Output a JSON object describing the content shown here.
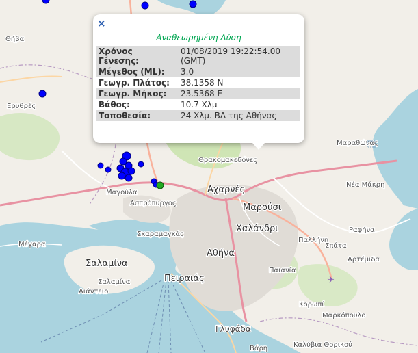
{
  "map": {
    "background_color": "#f2efe9",
    "sea_color": "#aad3df",
    "marker_color_recent": "#0000ff",
    "marker_color_selected": "#22aa22",
    "labels": {
      "thiva": "Θήβα",
      "erythres": "Ερυθρές",
      "magoula": "Μαγούλα",
      "aspropyrgos": "Ασπρόπυργος",
      "acharnes": "Αχαρνές",
      "marousi": "Μαρούσι",
      "chalandri": "Χαλάνδρι",
      "athina": "Αθήνα",
      "peiraias": "Πειραιάς",
      "salamina_island": "Σαλαμίνα",
      "salamina_town": "Σαλαμίνα",
      "aianteio": "Αιάντειο",
      "megara": "Μέγαρα",
      "skaramangas": "Σκαραμαγκάς",
      "thrakomakedones": "Θρακομακεδόνες",
      "marathonas": "Μαραθώνας",
      "nea_makri": "Νέα Μάκρη",
      "rafina": "Ραφήνα",
      "pallini": "Παλλήνη",
      "spata": "Σπάτα",
      "artemida": "Αρτέμιδα",
      "paiania": "Παιανία",
      "koropi": "Κορωπί",
      "markopoulo": "Μαρκόπουλο",
      "glyfada": "Γλυφάδα",
      "kalyvia": "Καλύβια Θορικού",
      "varis": "Βάρη"
    }
  },
  "popup": {
    "close_symbol": "×",
    "title": "Αναθεωρημένη Λύση",
    "rows": [
      {
        "label": "Χρόνος Γένεσης:",
        "value": "01/08/2019 19:22:54.00 (GMT)"
      },
      {
        "label": "Μέγεθος (ML):",
        "value": "3.0"
      },
      {
        "label": "Γεωγρ. Πλάτος:",
        "value": "38.1358 N"
      },
      {
        "label": "Γεωγρ. Μήκος:",
        "value": "23.5368 E"
      },
      {
        "label": "Βάθος:",
        "value": "10.7 Χλμ"
      },
      {
        "label": "Τοποθεσία:",
        "value": "24 Χλμ. ΒΔ της Αθήνας"
      }
    ]
  }
}
